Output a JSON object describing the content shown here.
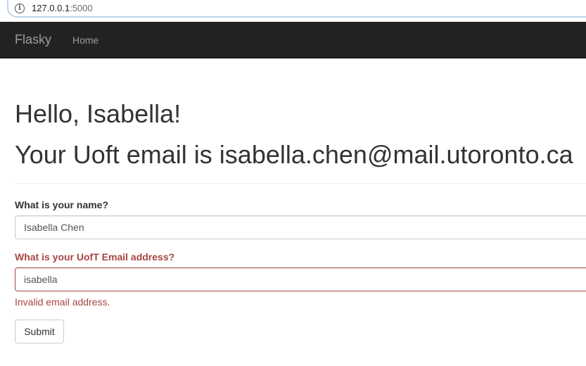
{
  "browser": {
    "url_host": "127.0.0.1",
    "url_port": ":5000",
    "info_icon": "info-icon"
  },
  "navbar": {
    "brand": "Flasky",
    "home_label": "Home",
    "bg_color": "#222222"
  },
  "page_header": {
    "greeting": "Hello, Isabella!",
    "email_line": "Your Uoft email is isabella.chen@mail.utoronto.ca"
  },
  "form": {
    "name_label": "What is your name?",
    "name_value": "Isabella Chen",
    "email_label": "What is your UofT Email address?",
    "email_value": "isabella",
    "email_error": "Invalid email address.",
    "submit_label": "Submit",
    "error_color": "#a94442"
  }
}
